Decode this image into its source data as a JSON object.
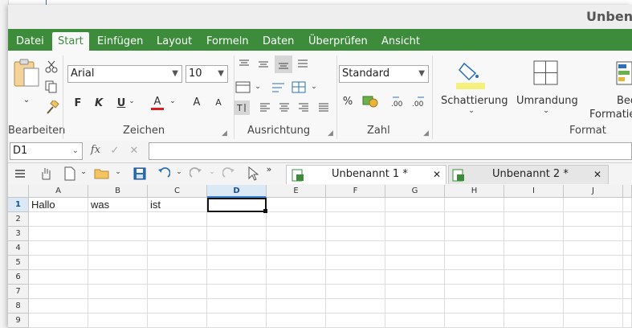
{
  "window": {
    "title": "Unbenannt"
  },
  "menu": {
    "tabs": [
      {
        "label": "Datei"
      },
      {
        "label": "Start"
      },
      {
        "label": "Einfügen"
      },
      {
        "label": "Layout"
      },
      {
        "label": "Formeln"
      },
      {
        "label": "Daten"
      },
      {
        "label": "Überprüfen"
      },
      {
        "label": "Ansicht"
      }
    ],
    "active": "Start"
  },
  "ribbon": {
    "groups": {
      "bearbeiten": "Bearbeiten",
      "zeichen": "Zeichen",
      "ausrichtung": "Ausrichtung",
      "zahl": "Zahl",
      "format": "Format"
    },
    "font_name": "Arial",
    "font_size": "10",
    "number_format": "Standard",
    "bold_label": "F",
    "italic_label": "K",
    "underline_label": "U",
    "font_color_label": "A",
    "grow_font_label": "A",
    "shrink_font_label": "A",
    "schattierung": "Schattierung",
    "umrandung": "Umrandung",
    "bedingte_line1": "Bedi",
    "bedingte_line2": "Formatie",
    "percent_label": "%",
    "font_color_accent": "#d42020",
    "fill_color_accent": "#f5f07a"
  },
  "formula_bar": {
    "name_box": "D1",
    "fx": "fx",
    "value": ""
  },
  "documents": {
    "tabs": [
      {
        "label": "Unbenannt 1 *",
        "active": true
      },
      {
        "label": "Unbenannt 2 *",
        "active": false
      }
    ]
  },
  "sheet": {
    "columns": [
      "A",
      "B",
      "C",
      "D",
      "E",
      "F",
      "G",
      "H",
      "I",
      "J"
    ],
    "selected_column": "D",
    "rows": [
      "1",
      "2",
      "3",
      "4",
      "5",
      "6",
      "7",
      "8",
      "9"
    ],
    "selected_row": "1",
    "cells": {
      "A1": "Hallo",
      "B1": "was",
      "C1": "ist"
    },
    "active_cell": "D1"
  },
  "colors": {
    "menubar": "#3c8c3c",
    "selection": "#3a7fd0"
  }
}
